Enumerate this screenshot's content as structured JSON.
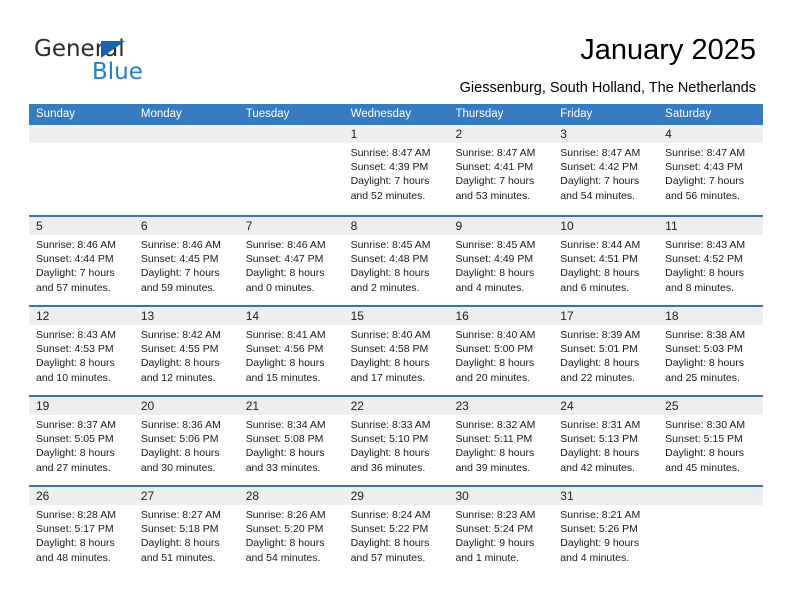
{
  "brand": {
    "name_part1": "General",
    "name_part2": "Blue",
    "primary_color": "#1f7fd4",
    "triangle_color": "#1566b0"
  },
  "header": {
    "title": "January 2025",
    "subtitle": "Giessenburg, South Holland, The Netherlands"
  },
  "calendar": {
    "header_bg": "#367bbf",
    "row_divider_color": "#3573b4",
    "day_band_bg": "#eeeeee",
    "weekdays": [
      "Sunday",
      "Monday",
      "Tuesday",
      "Wednesday",
      "Thursday",
      "Friday",
      "Saturday"
    ],
    "weeks": [
      [
        {
          "day": "",
          "lines": []
        },
        {
          "day": "",
          "lines": []
        },
        {
          "day": "",
          "lines": []
        },
        {
          "day": "1",
          "lines": [
            "Sunrise: 8:47 AM",
            "Sunset: 4:39 PM",
            "Daylight: 7 hours",
            "and 52 minutes."
          ]
        },
        {
          "day": "2",
          "lines": [
            "Sunrise: 8:47 AM",
            "Sunset: 4:41 PM",
            "Daylight: 7 hours",
            "and 53 minutes."
          ]
        },
        {
          "day": "3",
          "lines": [
            "Sunrise: 8:47 AM",
            "Sunset: 4:42 PM",
            "Daylight: 7 hours",
            "and 54 minutes."
          ]
        },
        {
          "day": "4",
          "lines": [
            "Sunrise: 8:47 AM",
            "Sunset: 4:43 PM",
            "Daylight: 7 hours",
            "and 56 minutes."
          ]
        }
      ],
      [
        {
          "day": "5",
          "lines": [
            "Sunrise: 8:46 AM",
            "Sunset: 4:44 PM",
            "Daylight: 7 hours",
            "and 57 minutes."
          ]
        },
        {
          "day": "6",
          "lines": [
            "Sunrise: 8:46 AM",
            "Sunset: 4:45 PM",
            "Daylight: 7 hours",
            "and 59 minutes."
          ]
        },
        {
          "day": "7",
          "lines": [
            "Sunrise: 8:46 AM",
            "Sunset: 4:47 PM",
            "Daylight: 8 hours",
            "and 0 minutes."
          ]
        },
        {
          "day": "8",
          "lines": [
            "Sunrise: 8:45 AM",
            "Sunset: 4:48 PM",
            "Daylight: 8 hours",
            "and 2 minutes."
          ]
        },
        {
          "day": "9",
          "lines": [
            "Sunrise: 8:45 AM",
            "Sunset: 4:49 PM",
            "Daylight: 8 hours",
            "and 4 minutes."
          ]
        },
        {
          "day": "10",
          "lines": [
            "Sunrise: 8:44 AM",
            "Sunset: 4:51 PM",
            "Daylight: 8 hours",
            "and 6 minutes."
          ]
        },
        {
          "day": "11",
          "lines": [
            "Sunrise: 8:43 AM",
            "Sunset: 4:52 PM",
            "Daylight: 8 hours",
            "and 8 minutes."
          ]
        }
      ],
      [
        {
          "day": "12",
          "lines": [
            "Sunrise: 8:43 AM",
            "Sunset: 4:53 PM",
            "Daylight: 8 hours",
            "and 10 minutes."
          ]
        },
        {
          "day": "13",
          "lines": [
            "Sunrise: 8:42 AM",
            "Sunset: 4:55 PM",
            "Daylight: 8 hours",
            "and 12 minutes."
          ]
        },
        {
          "day": "14",
          "lines": [
            "Sunrise: 8:41 AM",
            "Sunset: 4:56 PM",
            "Daylight: 8 hours",
            "and 15 minutes."
          ]
        },
        {
          "day": "15",
          "lines": [
            "Sunrise: 8:40 AM",
            "Sunset: 4:58 PM",
            "Daylight: 8 hours",
            "and 17 minutes."
          ]
        },
        {
          "day": "16",
          "lines": [
            "Sunrise: 8:40 AM",
            "Sunset: 5:00 PM",
            "Daylight: 8 hours",
            "and 20 minutes."
          ]
        },
        {
          "day": "17",
          "lines": [
            "Sunrise: 8:39 AM",
            "Sunset: 5:01 PM",
            "Daylight: 8 hours",
            "and 22 minutes."
          ]
        },
        {
          "day": "18",
          "lines": [
            "Sunrise: 8:38 AM",
            "Sunset: 5:03 PM",
            "Daylight: 8 hours",
            "and 25 minutes."
          ]
        }
      ],
      [
        {
          "day": "19",
          "lines": [
            "Sunrise: 8:37 AM",
            "Sunset: 5:05 PM",
            "Daylight: 8 hours",
            "and 27 minutes."
          ]
        },
        {
          "day": "20",
          "lines": [
            "Sunrise: 8:36 AM",
            "Sunset: 5:06 PM",
            "Daylight: 8 hours",
            "and 30 minutes."
          ]
        },
        {
          "day": "21",
          "lines": [
            "Sunrise: 8:34 AM",
            "Sunset: 5:08 PM",
            "Daylight: 8 hours",
            "and 33 minutes."
          ]
        },
        {
          "day": "22",
          "lines": [
            "Sunrise: 8:33 AM",
            "Sunset: 5:10 PM",
            "Daylight: 8 hours",
            "and 36 minutes."
          ]
        },
        {
          "day": "23",
          "lines": [
            "Sunrise: 8:32 AM",
            "Sunset: 5:11 PM",
            "Daylight: 8 hours",
            "and 39 minutes."
          ]
        },
        {
          "day": "24",
          "lines": [
            "Sunrise: 8:31 AM",
            "Sunset: 5:13 PM",
            "Daylight: 8 hours",
            "and 42 minutes."
          ]
        },
        {
          "day": "25",
          "lines": [
            "Sunrise: 8:30 AM",
            "Sunset: 5:15 PM",
            "Daylight: 8 hours",
            "and 45 minutes."
          ]
        }
      ],
      [
        {
          "day": "26",
          "lines": [
            "Sunrise: 8:28 AM",
            "Sunset: 5:17 PM",
            "Daylight: 8 hours",
            "and 48 minutes."
          ]
        },
        {
          "day": "27",
          "lines": [
            "Sunrise: 8:27 AM",
            "Sunset: 5:18 PM",
            "Daylight: 8 hours",
            "and 51 minutes."
          ]
        },
        {
          "day": "28",
          "lines": [
            "Sunrise: 8:26 AM",
            "Sunset: 5:20 PM",
            "Daylight: 8 hours",
            "and 54 minutes."
          ]
        },
        {
          "day": "29",
          "lines": [
            "Sunrise: 8:24 AM",
            "Sunset: 5:22 PM",
            "Daylight: 8 hours",
            "and 57 minutes."
          ]
        },
        {
          "day": "30",
          "lines": [
            "Sunrise: 8:23 AM",
            "Sunset: 5:24 PM",
            "Daylight: 9 hours",
            "and 1 minute."
          ]
        },
        {
          "day": "31",
          "lines": [
            "Sunrise: 8:21 AM",
            "Sunset: 5:26 PM",
            "Daylight: 9 hours",
            "and 4 minutes."
          ]
        },
        {
          "day": "",
          "lines": []
        }
      ]
    ]
  }
}
